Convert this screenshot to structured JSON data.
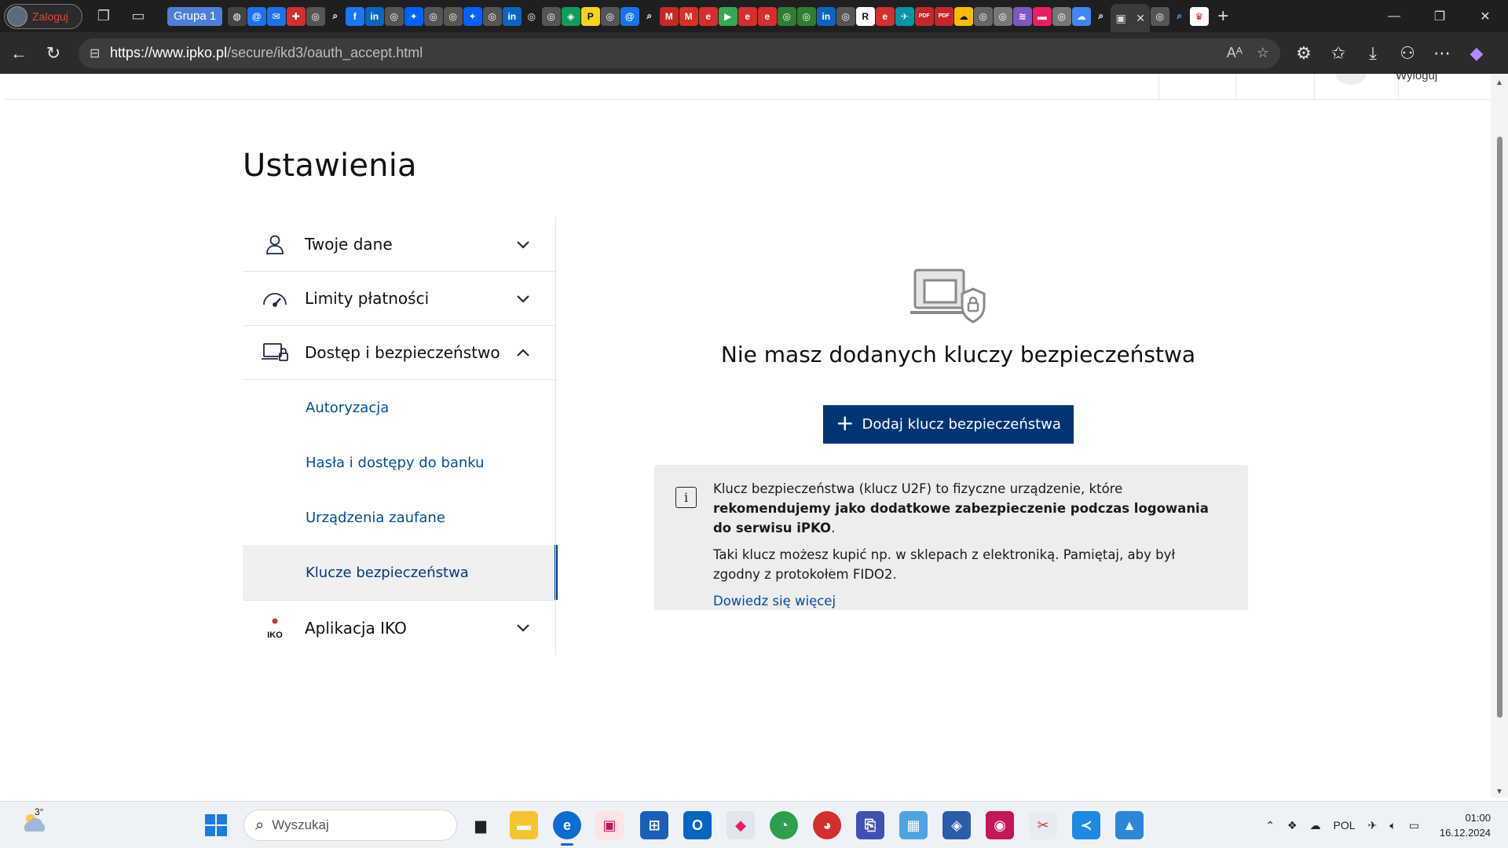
{
  "browser": {
    "profile_label": "Zaloguj",
    "tab_group_label": "Grupa 1",
    "url_host": "https://www.ipko.pl",
    "url_path": "/secure/ikd3/oauth_accept.html",
    "mini_tab_glyphs": [
      "◍",
      "@",
      "✉",
      "✚",
      "◎",
      "⌕",
      "f",
      "in",
      "◎",
      "✦",
      "◎",
      "◎",
      "✦",
      "◎",
      "in",
      "◎",
      "◎",
      "◈",
      "P",
      "◎",
      "@",
      "⌕",
      "M",
      "M",
      "e",
      "▶",
      "e",
      "e",
      "◎",
      "◎",
      "in",
      "◎",
      "R",
      "e",
      "✈",
      "PDF",
      "PDF",
      "☁",
      "◎",
      "◎",
      "≋",
      "▬",
      "◎",
      "☁",
      "⌕"
    ],
    "mini_tab_colors": [
      "#444",
      "#1a73e8",
      "#1a73e8",
      "#d32f2f",
      "#555",
      "#1f1f1f",
      "#1877f2",
      "#0a66c2",
      "#555",
      "#0061fe",
      "#555",
      "#555",
      "#0061fe",
      "#555",
      "#0a66c2",
      "#1f1f1f",
      "#555",
      "#0f9d58",
      "#f7d417",
      "#555",
      "#1a73e8",
      "#1f1f1f",
      "#c62828",
      "#d93025",
      "#d32f2f",
      "#34a853",
      "#d32f2f",
      "#d32f2f",
      "#2e7d32",
      "#2e7d32",
      "#0a66c2",
      "#555",
      "#ffffff",
      "#d32f2f",
      "#0097a7",
      "#c62828",
      "#c62828",
      "#fbbc04",
      "#666",
      "#777",
      "#7e57c2",
      "#e91e63",
      "#777",
      "#4285f4",
      "#1f1f1f"
    ]
  },
  "page": {
    "header_logout": "Wyloguj",
    "title": "Ustawienia",
    "nav": {
      "items": [
        {
          "label": "Twoje dane",
          "icon": "person-icon",
          "expanded": false
        },
        {
          "label": "Limity płatności",
          "icon": "gauge-icon",
          "expanded": false
        },
        {
          "label": "Dostęp i bezpieczeństwo",
          "icon": "laptop-lock-icon",
          "expanded": true
        },
        {
          "label": "Aplikacja IKO",
          "icon": "iko-logo-icon",
          "expanded": false
        }
      ],
      "sub_items": [
        {
          "label": "Autoryzacja",
          "selected": false
        },
        {
          "label": "Hasła i dostępy do banku",
          "selected": false
        },
        {
          "label": "Urządzenia zaufane",
          "selected": false
        },
        {
          "label": "Klucze bezpieczeństwa",
          "selected": true
        }
      ],
      "iko_logo_text": "IKO"
    },
    "empty_state": {
      "illustration": "laptop-shield-icon",
      "title": "Nie masz dodanych kluczy bezpieczeństwa",
      "add_button": "Dodaj klucz bezpieczeństwa"
    },
    "info": {
      "p1_normal": "Klucz bezpieczeństwa (klucz U2F) to fizyczne urządzenie, które ",
      "p1_bold": "rekomendujemy jako dodatkowe zabezpieczenie podczas logowania do serwisu iPKO",
      "p1_end": ".",
      "p2": "Taki klucz możesz kupić np. w sklepach z elektroniką. Pamiętaj, aby był zgodny z protokołem FIDO2.",
      "link": "Dowiedz się więcej"
    }
  },
  "taskbar": {
    "weather_temp": "3°",
    "search_placeholder": "Wyszukaj",
    "language": "POL",
    "time": "01:00",
    "date": "16.12.2024"
  },
  "colors": {
    "brand_navy": "#003574",
    "link_blue": "#004c9a",
    "info_bg": "#ededed"
  }
}
